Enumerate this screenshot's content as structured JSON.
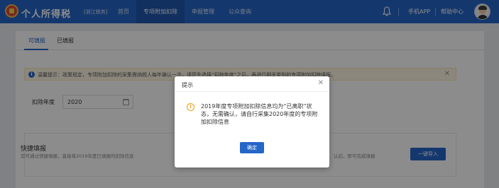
{
  "header": {
    "app_title": "个人所得税",
    "region": "[浙江税务]",
    "nav": [
      "首页",
      "专项附加扣除",
      "申报管理",
      "公众查询"
    ],
    "active_nav": 1,
    "mobile_app": "手机APP",
    "help_center": "帮助中心",
    "brand_color": "#2566c9"
  },
  "tabs": [
    "可填报",
    "已填报"
  ],
  "notice": {
    "text": "温馨提示：政策规定，专项附加扣除的采集需纳税人每年确认一次，请您先选择“扣除年度”之后，再进行相关类别的专项附加扣除填报。"
  },
  "form": {
    "year_label": "扣除年度",
    "year_value": "2020"
  },
  "quick_fill": {
    "title": "快捷填报",
    "desc_left": "您可通过快捷填报，直接将2019年度已填报的扣除信息",
    "desc_right": "认后，即可完成填报",
    "import_button": "一键导入"
  },
  "dialog": {
    "title": "提示",
    "message": "2019年度专项附加扣除信息均为“已离职”状态，无需确认，请自行采集2020年度的专项附加扣除信息",
    "ok": "确定",
    "warn_color": "#f39c12"
  }
}
